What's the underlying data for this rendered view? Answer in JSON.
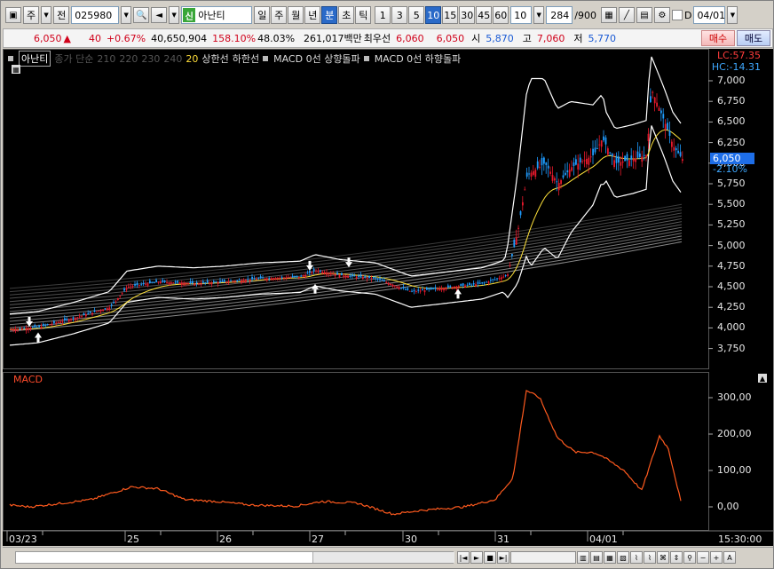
{
  "toolbar": {
    "market_type": "주",
    "market_scope": "전",
    "stock_code": "025980",
    "stock_tag": "신",
    "stock_name": "아난티",
    "period_buttons": [
      "일",
      "주",
      "월",
      "년",
      "분",
      "초",
      "틱"
    ],
    "active_period": "분",
    "interval_buttons": [
      "1",
      "3",
      "5",
      "10",
      "15",
      "30",
      "45",
      "60"
    ],
    "active_interval": "10",
    "interval_select": "10",
    "count_current": "284",
    "count_total": "/900",
    "d_label": "D",
    "date_value": "04/01"
  },
  "quote": {
    "price": "6,050",
    "arrow": "▲",
    "change": "40",
    "change_pct": "+0.67%",
    "volume": "40,650,904",
    "volume_ratio": "158.10%",
    "turnover": "48.03%",
    "amount": "261,017백만",
    "best_bid_label": "최우선",
    "best_ask": "6,060",
    "best_bid": "6,050",
    "open_label": "시",
    "open": "5,870",
    "high_label": "고",
    "high": "7,060",
    "low_label": "저",
    "low": "5,770",
    "buy_label": "매수",
    "sell_label": "매도"
  },
  "legend": {
    "stock": "아난티",
    "ma_label": "종가 단순",
    "ma_periods": [
      "210",
      "220",
      "230",
      "240"
    ],
    "ma20": "20",
    "upper": "상한선",
    "lower": "하한선",
    "macd_up": "MACD 0선 상향돌파",
    "macd_down": "MACD 0선 하향돌파"
  },
  "corner_values": {
    "lc": "LC:57.35",
    "hc": "HC:-14.31"
  },
  "price_axis": [
    "7,000",
    "6,750",
    "6,500",
    "6,250",
    "6,000",
    "5,750",
    "5,500",
    "5,250",
    "5,000",
    "4,750",
    "4,500",
    "4,250",
    "4,000",
    "3,750"
  ],
  "current_price_box": "6,050",
  "current_pct": "-2.10%",
  "macd_title": "MACD",
  "macd_axis": [
    "300,00",
    "200,00",
    "100,00",
    "0,00"
  ],
  "x_axis": [
    "03/23",
    "25",
    "26",
    "27",
    "30",
    "31",
    "04/01"
  ],
  "time_clock": "15:30:00",
  "colors": {
    "up": "#e8192c",
    "down": "#1f9cff",
    "ma20": "#ffe23a",
    "bollinger": "#ffffff",
    "macd": "#ff5a1e"
  }
}
